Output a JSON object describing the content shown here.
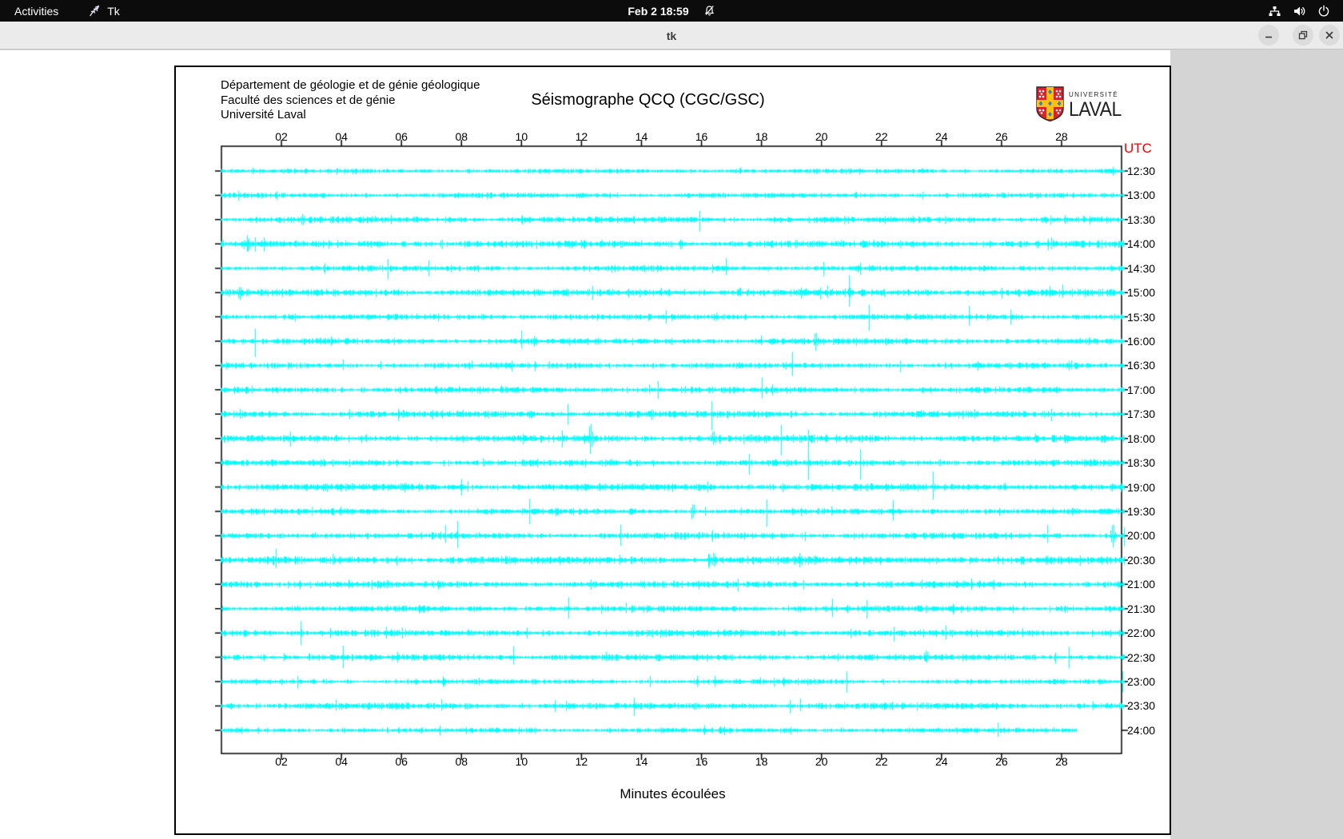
{
  "topbar": {
    "activities_label": "Activities",
    "app_label": "Tk",
    "clock": "Feb 2 18:59",
    "bg": "#0c0c0c"
  },
  "titlebar": {
    "title": "tk"
  },
  "canvas_header": {
    "line1": "Département de géologie et de génie géologique",
    "line2": "Faculté des sciences et de génie",
    "line3": "Université Laval"
  },
  "logo": {
    "small_text": "UNIVERSITÉ",
    "large_text": "LAVAL",
    "shield_red": "#d8232f",
    "shield_gold": "#ffc20e",
    "shield_blue": "#2f83c5"
  },
  "chart_data": {
    "type": "line",
    "subtype": "helicorder-seismogram",
    "title": "Séismographe QCQ (CGC/GSC)",
    "xlabel": "Minutes écoulées",
    "right_axis_title": "UTC",
    "right_axis_title_color": "#f40000",
    "trace_color": "#00ffff",
    "x_range_minutes": [
      0,
      30
    ],
    "x_ticks": [
      "02",
      "04",
      "06",
      "08",
      "10",
      "12",
      "14",
      "16",
      "18",
      "20",
      "22",
      "24",
      "26",
      "28"
    ],
    "rows": [
      {
        "time": "12:30",
        "intensity": 0.75
      },
      {
        "time": "13:00",
        "intensity": 0.85
      },
      {
        "time": "13:30",
        "intensity": 1.0
      },
      {
        "time": "14:00",
        "intensity": 1.1
      },
      {
        "time": "14:30",
        "intensity": 0.9
      },
      {
        "time": "15:00",
        "intensity": 1.15
      },
      {
        "time": "15:30",
        "intensity": 0.9
      },
      {
        "time": "16:00",
        "intensity": 1.0
      },
      {
        "time": "16:30",
        "intensity": 0.9
      },
      {
        "time": "17:00",
        "intensity": 1.0
      },
      {
        "time": "17:30",
        "intensity": 1.1
      },
      {
        "time": "18:00",
        "intensity": 1.1
      },
      {
        "time": "18:30",
        "intensity": 1.0
      },
      {
        "time": "19:00",
        "intensity": 1.15
      },
      {
        "time": "19:30",
        "intensity": 0.95
      },
      {
        "time": "20:00",
        "intensity": 1.0
      },
      {
        "time": "20:30",
        "intensity": 1.2
      },
      {
        "time": "21:00",
        "intensity": 1.1
      },
      {
        "time": "21:30",
        "intensity": 0.95
      },
      {
        "time": "22:00",
        "intensity": 1.1
      },
      {
        "time": "22:30",
        "intensity": 1.0
      },
      {
        "time": "23:00",
        "intensity": 0.8
      },
      {
        "time": "23:30",
        "intensity": 1.05
      },
      {
        "time": "24:00",
        "intensity": 0.8,
        "end_minute": 28.5
      }
    ],
    "events": [
      {
        "time": "13:30",
        "minute": 2.7,
        "amplitude": 7
      },
      {
        "time": "14:00",
        "minute": 0.9,
        "amplitude": 7
      },
      {
        "time": "15:00",
        "minute": 0.6,
        "amplitude": 8
      },
      {
        "time": "16:00",
        "minute": 19.8,
        "amplitude": 11
      },
      {
        "time": "18:00",
        "minute": 12.3,
        "amplitude": 19
      },
      {
        "time": "18:00",
        "minute": 16.4,
        "amplitude": 9
      },
      {
        "time": "19:30",
        "minute": 15.7,
        "amplitude": 12
      },
      {
        "time": "20:00",
        "minute": 29.7,
        "amplitude": 17
      },
      {
        "time": "20:30",
        "minute": 16.4,
        "amplitude": 8
      },
      {
        "time": "22:30",
        "minute": 23.5,
        "amplitude": 8
      }
    ]
  }
}
